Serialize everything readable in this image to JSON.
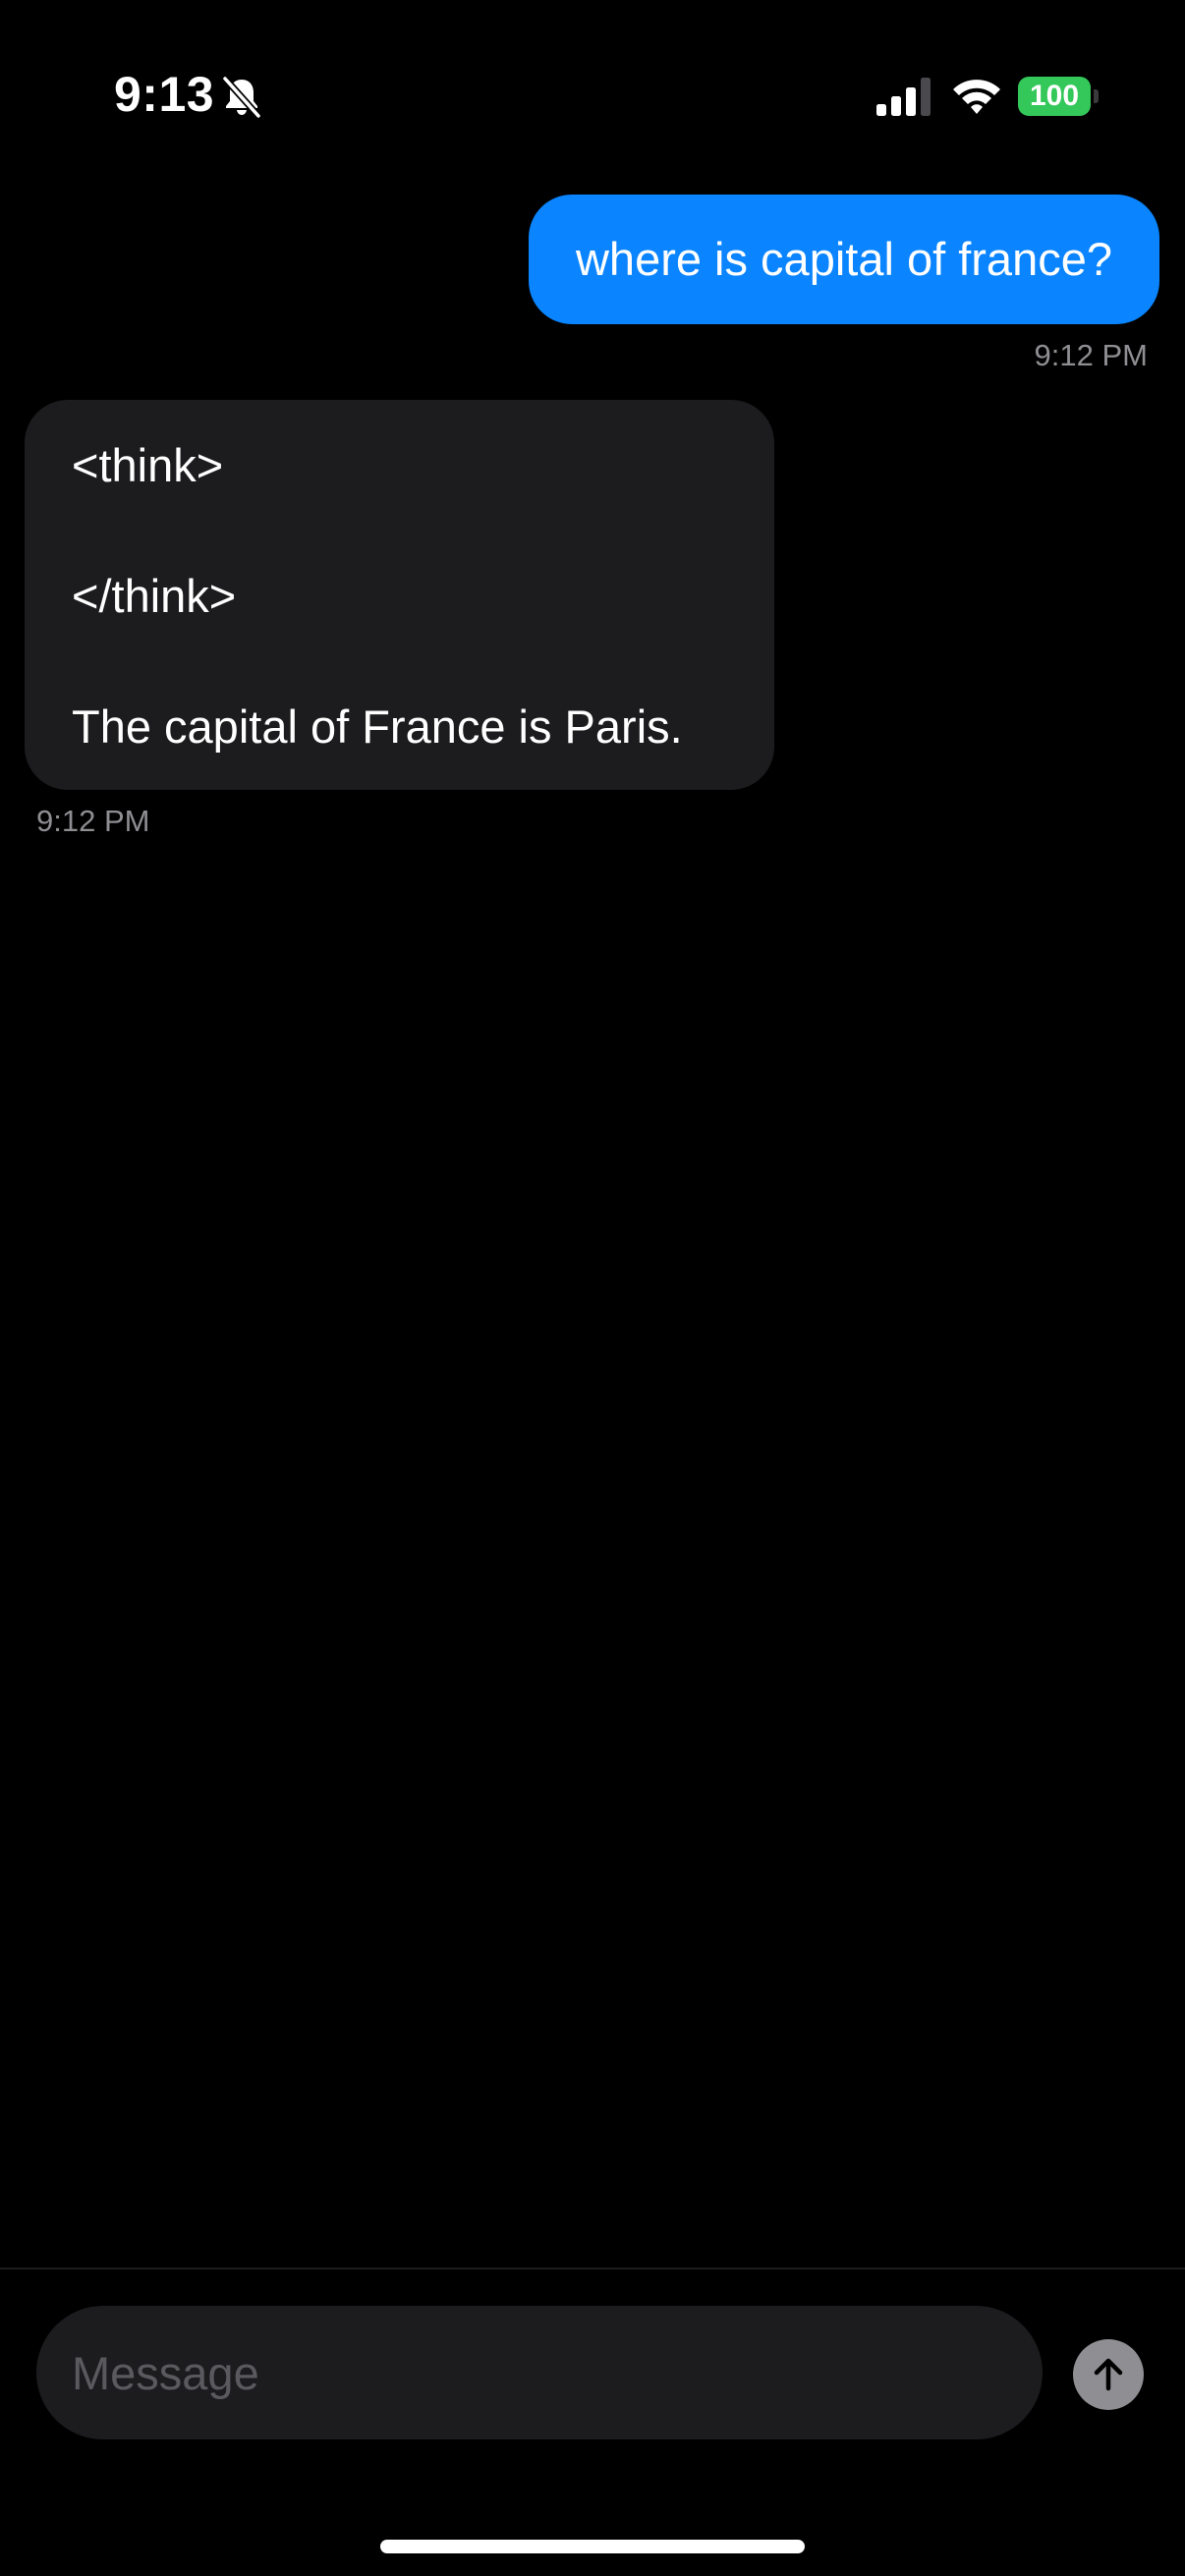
{
  "status_bar": {
    "time": "9:13",
    "battery_level": "100",
    "icons": [
      "bell-slash-icon",
      "cellular-signal-icon",
      "wifi-icon",
      "battery-icon"
    ],
    "battery_color": "#34c759"
  },
  "conversation": {
    "messages": [
      {
        "role": "user",
        "lines": [
          "where is capital of france?"
        ],
        "time": "9:12 PM",
        "bubble_color": "#0a84ff"
      },
      {
        "role": "assistant",
        "lines": [
          "<think>",
          "</think>",
          "The capital of France is Paris."
        ],
        "time": "9:12 PM",
        "bubble_color": "#1c1c1e"
      }
    ]
  },
  "composer": {
    "placeholder": "Message",
    "value": "",
    "send_icon": "arrow-up-icon"
  }
}
